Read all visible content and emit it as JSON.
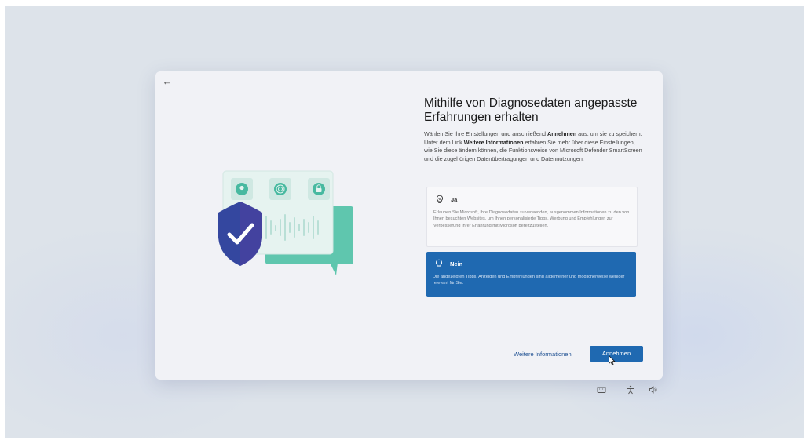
{
  "dialog": {
    "back_label": "←",
    "title": "Mithilfe von Diagnosedaten angepasste Erfahrungen erhalten",
    "description": {
      "part1": "Wählen Sie Ihre Einstellungen und anschließend ",
      "bold1": "Annehmen",
      "part2": " aus, um sie zu speichern. Unter dem Link ",
      "bold2": "Weitere Informationen",
      "part3": " erfahren Sie mehr über diese Einstellungen, wie Sie diese ändern können, die Funktionsweise von Microsoft Defender SmartScreen und die zugehörigen Datenübertragungen und Datennutzungen."
    },
    "options": [
      {
        "label": "Ja",
        "text": "Erlauben Sie Microsoft, Ihre Diagnosedaten zu verwenden, ausgenommen Informationen zu den von Ihnen besuchten Websites, um Ihnen personalisierte Tipps, Werbung und Empfehlungen zur Verbesserung Ihrer Erfahrung mit Microsoft bereitzustellen.",
        "selected": false,
        "icon": "lightbulb-icon"
      },
      {
        "label": "Nein",
        "text": "Die angezeigten Tipps, Anzeigen und Empfehlungen sind allgemeiner und möglicherweise weniger relevant für Sie.",
        "selected": true,
        "icon": "lightbulb-off-icon"
      }
    ],
    "more_info_link": "Weitere Informationen",
    "accept_button": "Annehmen"
  },
  "tray": {
    "icons": [
      "keyboard-icon",
      "accessibility-icon",
      "volume-icon"
    ]
  },
  "colors": {
    "accent": "#1f69b1",
    "illustration_panel": "#d9eeea",
    "illustration_green": "#5bc8ad",
    "shield": "#34479f",
    "bubble": "#5fc6ae"
  }
}
